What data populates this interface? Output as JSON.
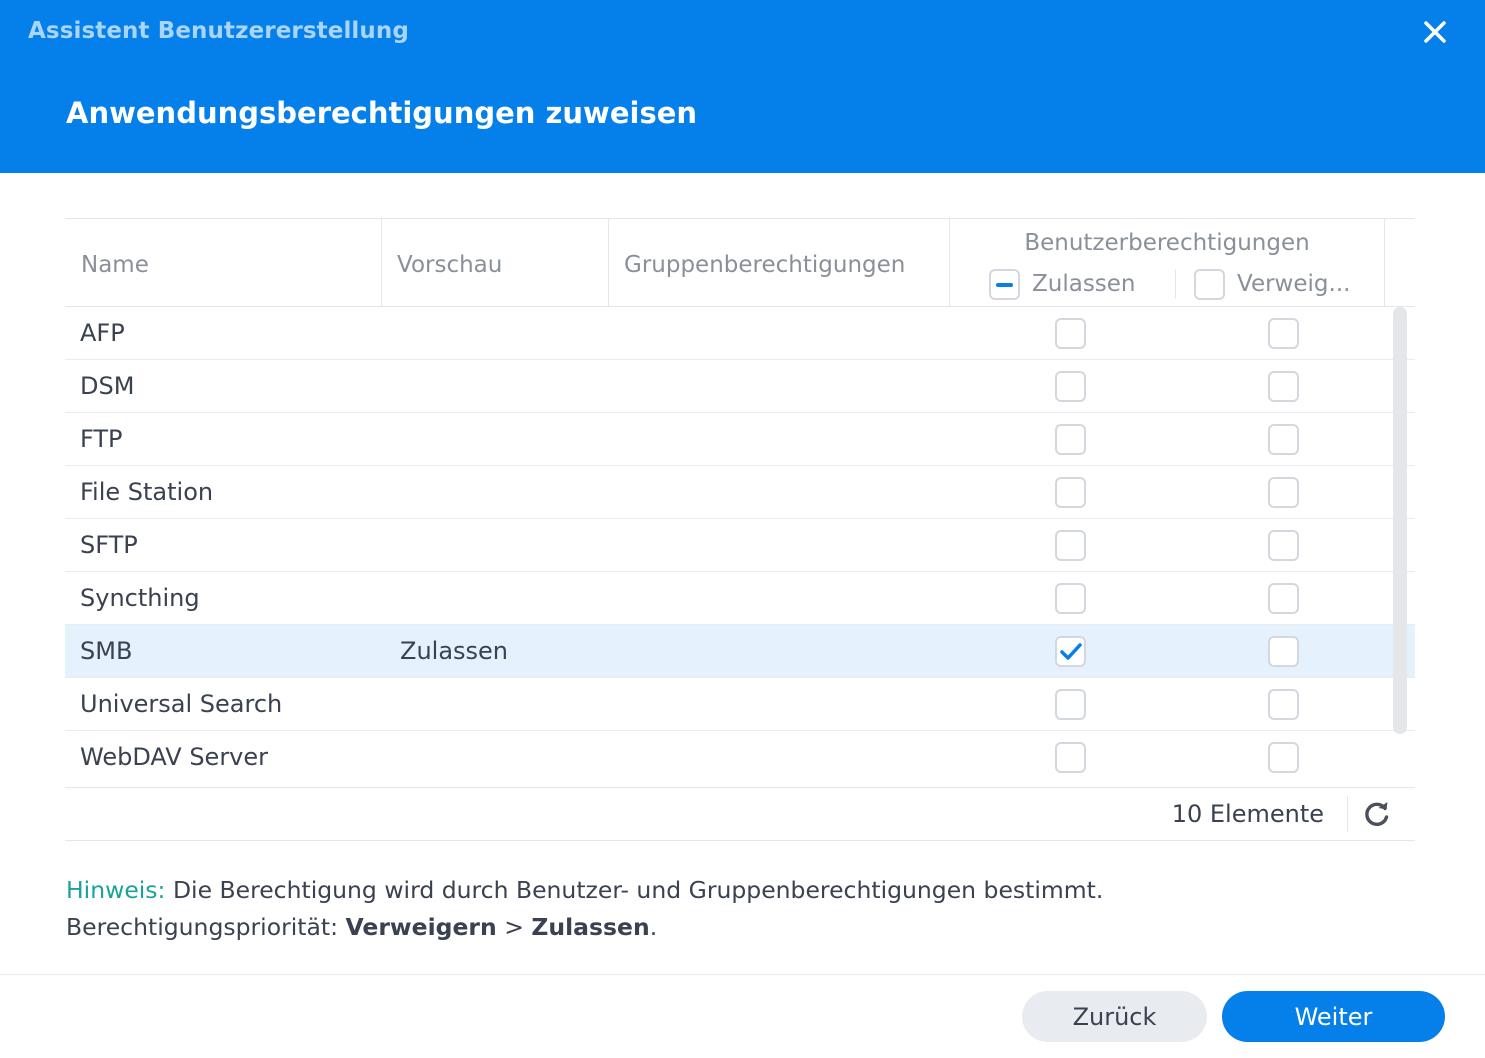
{
  "window": {
    "title": "Assistent Benutzererstellung"
  },
  "step": {
    "title": "Anwendungsberechtigungen zuweisen"
  },
  "grid": {
    "columns": {
      "name": "Name",
      "preview": "Vorschau",
      "group_perms": "Gruppenberechtigungen",
      "user_perms": "Benutzerberechtigungen",
      "allow": "Zulassen",
      "deny": "Verweig..."
    },
    "header_allow_state": "indeterminate",
    "header_deny_state": "unchecked",
    "rows": [
      {
        "name": "AFP",
        "preview": "",
        "group": "",
        "allow": false,
        "deny": false
      },
      {
        "name": "DSM",
        "preview": "",
        "group": "",
        "allow": false,
        "deny": false
      },
      {
        "name": "FTP",
        "preview": "",
        "group": "",
        "allow": false,
        "deny": false
      },
      {
        "name": "File Station",
        "preview": "",
        "group": "",
        "allow": false,
        "deny": false
      },
      {
        "name": "SFTP",
        "preview": "",
        "group": "",
        "allow": false,
        "deny": false
      },
      {
        "name": "Syncthing",
        "preview": "",
        "group": "",
        "allow": false,
        "deny": false
      },
      {
        "name": "SMB",
        "preview": "Zulassen",
        "group": "",
        "allow": true,
        "deny": false,
        "selected": true
      },
      {
        "name": "Universal Search",
        "preview": "",
        "group": "",
        "allow": false,
        "deny": false
      },
      {
        "name": "WebDAV Server",
        "preview": "",
        "group": "",
        "allow": false,
        "deny": false
      }
    ],
    "count_label": "10 Elemente"
  },
  "note": {
    "hint_label": "Hinweis:",
    "line1": " Die Berechtigung wird durch Benutzer- und Gruppenberechtigungen bestimmt.",
    "line2_prefix": "Berechtigungspriorität: ",
    "deny_bold": "Verweigern",
    "separator": " > ",
    "allow_bold": "Zulassen",
    "suffix": "."
  },
  "buttons": {
    "back": "Zurück",
    "next": "Weiter"
  },
  "colors": {
    "accent": "#057fea",
    "selected_row": "#e5f1fd",
    "hint": "#1aa39a"
  }
}
